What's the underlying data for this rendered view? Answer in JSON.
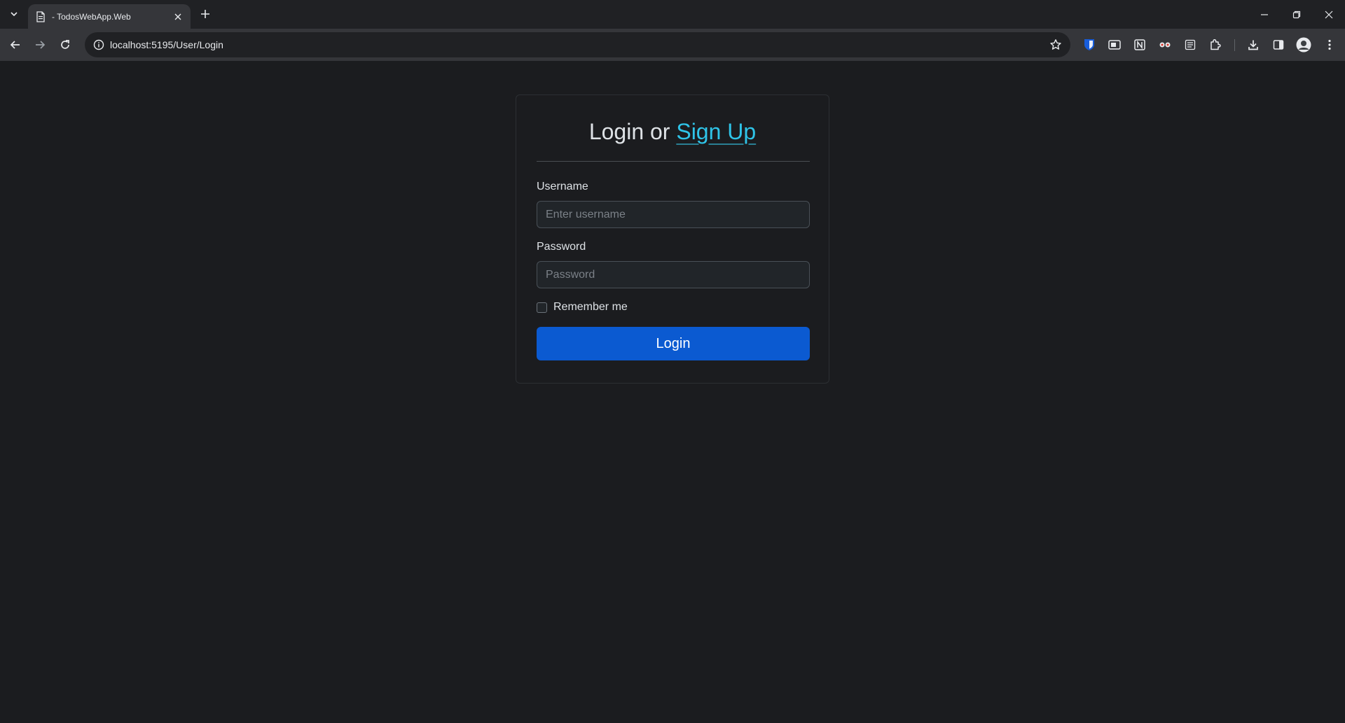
{
  "browser": {
    "tab_title": "- TodosWebApp.Web",
    "url": "localhost:5195/User/Login"
  },
  "login": {
    "heading_prefix": "Login or",
    "signup_link": "Sign Up",
    "username_label": "Username",
    "username_placeholder": "Enter username",
    "username_value": "",
    "password_label": "Password",
    "password_placeholder": "Password",
    "password_value": "",
    "remember_label": "Remember me",
    "remember_checked": false,
    "submit_label": "Login"
  },
  "colors": {
    "page_bg": "#1b1c1f",
    "accent_link": "#2fc4e8",
    "primary_button": "#0b5ad1"
  },
  "icons": {
    "tabstrip": [
      "tab-search-icon",
      "page-favicon-icon",
      "close-tab-icon",
      "new-tab-icon",
      "minimize-icon",
      "restore-icon",
      "close-window-icon"
    ],
    "toolbar": [
      "back-icon",
      "forward-icon",
      "reload-icon",
      "site-info-icon",
      "bookmark-star-icon",
      "bitwarden-extension-icon",
      "extension-icon",
      "notion-extension-icon",
      "glasses-extension-icon",
      "reader-extension-icon",
      "extensions-puzzle-icon",
      "download-icon",
      "side-panel-icon",
      "profile-avatar-icon",
      "menu-kebab-icon"
    ]
  }
}
